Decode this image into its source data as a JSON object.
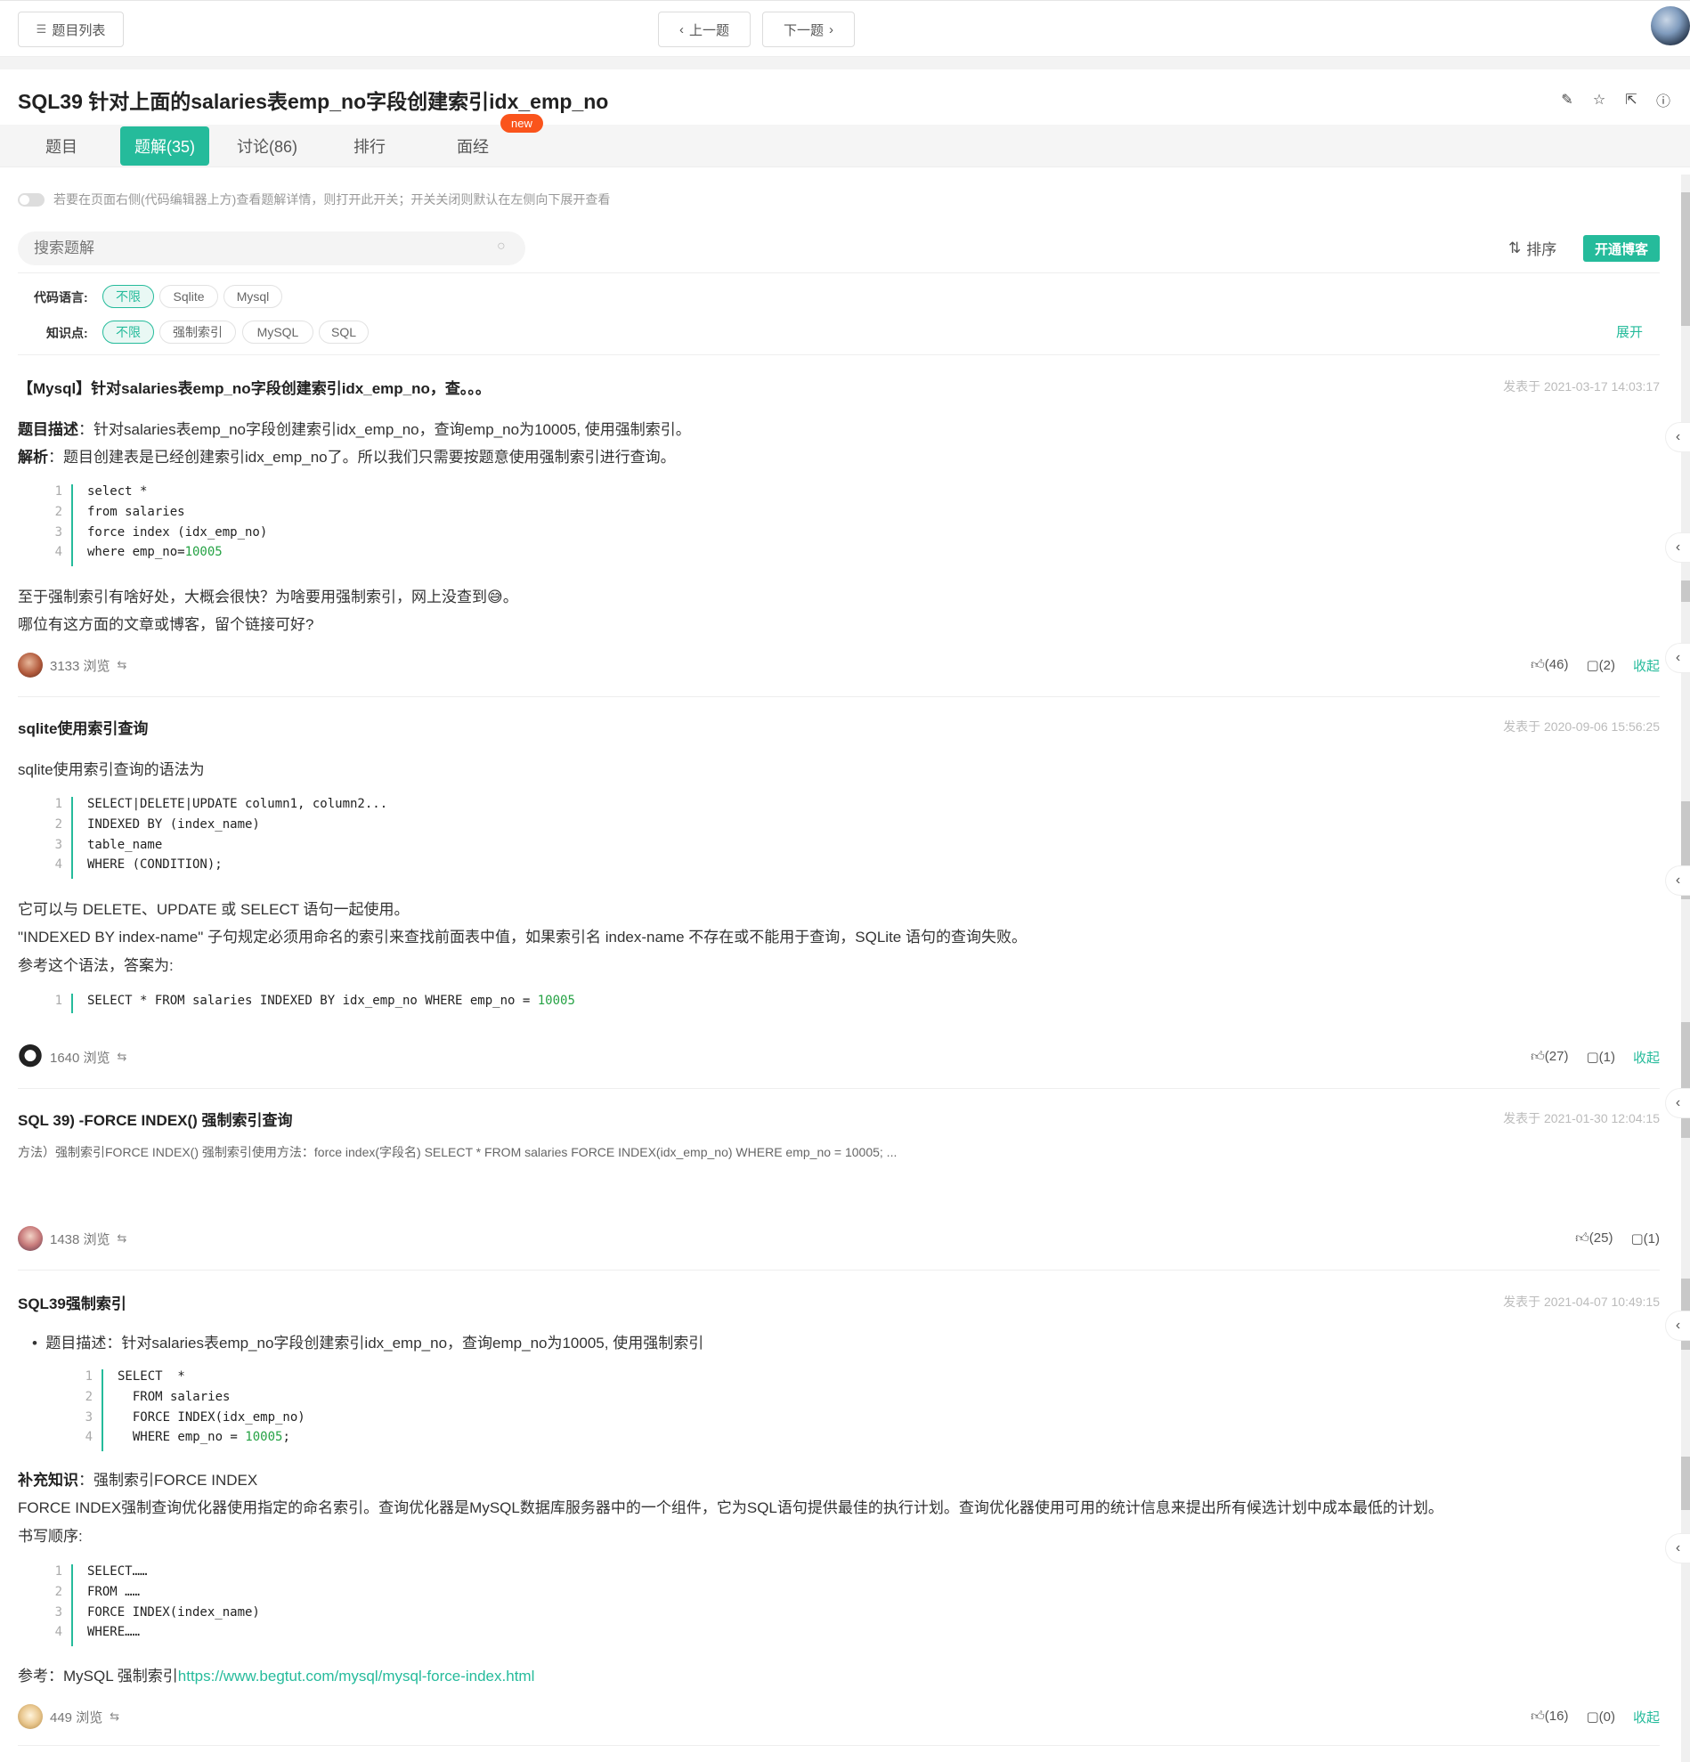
{
  "topbar": {
    "list_label": "题目列表",
    "prev_label": "上一题",
    "next_label": "下一题"
  },
  "problem": {
    "title": "SQL39  针对上面的salaries表emp_no字段创建索引idx_emp_no"
  },
  "tabs": [
    {
      "label": "题目"
    },
    {
      "label": "题解(35)"
    },
    {
      "label": "讨论(86)"
    },
    {
      "label": "排行"
    },
    {
      "label": "面经"
    }
  ],
  "new_badge": "new",
  "toggle_hint": "若要在页面右侧(代码编辑器上方)查看题解详情，则打开此开关；开关关闭则默认在左侧向下展开查看",
  "search": {
    "placeholder": "搜索题解"
  },
  "sort_label": "排序",
  "blog_label": "开通博客",
  "filters": {
    "lang_label": "代码语言:",
    "lang_options": [
      "不限",
      "Sqlite",
      "Mysql"
    ],
    "kp_label": "知识点:",
    "kp_options": [
      "不限",
      "强制索引",
      "MySQL",
      "SQL"
    ],
    "expand": "展开"
  },
  "posts": [
    {
      "title": "【Mysql】针对salaries表emp_no字段创建索引idx_emp_no，查。。。",
      "date": "发表于 2021-03-17 14:03:17",
      "desc_label": "题目描述",
      "desc": "：针对salaries表emp_no字段创建索引idx_emp_no，查询emp_no为10005, 使用强制索引。",
      "analysis_label": "解析",
      "analysis": "：题目创建表是已经创建索引idx_emp_no了。所以我们只需要按题意使用强制索引进行查询。",
      "code": [
        "select *",
        "from salaries",
        "force index (idx_emp_no)",
        "where emp_no="
      ],
      "code_num": "10005",
      "extra1": "至于强制索引有啥好处，大概会很快？为啥要用强制索引，网上没查到😅。",
      "extra2": "哪位有这方面的文章或博客，留个链接可好?",
      "views": "3133 浏览",
      "likes": "(46)",
      "comments": "(2)",
      "collapse": "收起"
    },
    {
      "title": "sqlite使用索引查询",
      "date": "发表于 2020-09-06 15:56:25",
      "intro": "sqlite使用索引查询的语法为",
      "code": [
        "SELECT|DELETE|UPDATE column1, column2...",
        "INDEXED BY (index_name)",
        "table_name",
        "WHERE (CONDITION);"
      ],
      "p1": "它可以与 DELETE、UPDATE 或 SELECT 语句一起使用。",
      "p2": "\"INDEXED BY index-name\" 子句规定必须用命名的索引来查找前面表中值，如果索引名 index-name 不存在或不能用于查询，SQLite 语句的查询失败。",
      "p3": "参考这个语法，答案为:",
      "code2": "SELECT * FROM salaries INDEXED BY idx_emp_no WHERE emp_no = ",
      "code2_num": "10005",
      "views": "1640 浏览",
      "likes": "(27)",
      "comments": "(1)",
      "collapse": "收起"
    },
    {
      "title": "SQL 39) -FORCE INDEX() 强制索引查询",
      "date": "发表于 2021-01-30 12:04:15",
      "summary": "方法）强制索引FORCE INDEX() 强制索引使用方法：force index(字段名) SELECT * FROM salaries FORCE INDEX(idx_emp_no) WHERE emp_no = 10005; ...",
      "views": "1438 浏览",
      "likes": "(25)",
      "comments": "(1)"
    },
    {
      "title": "SQL39强制索引",
      "date": "发表于 2021-04-07 10:49:15",
      "bullet": "题目描述：针对salaries表emp_no字段创建索引idx_emp_no，查询emp_no为10005, 使用强制索引",
      "code": [
        "SELECT  *",
        "  FROM salaries",
        "  FORCE INDEX(idx_emp_no)",
        "  WHERE emp_no = "
      ],
      "code_num": "10005",
      "supp_label": "补充知识",
      "supp": "：强制索引FORCE INDEX",
      "p1": "FORCE INDEX强制查询优化器使用指定的命名索引。查询优化器是MySQL数据库服务器中的一个组件，它为SQL语句提供最佳的执行计划。查询优化器使用可用的统计信息来提出所有候选计划中成本最低的计划。",
      "p2": "书写顺序:",
      "code2": [
        "SELECT……",
        "FROM ……",
        "FORCE INDEX(index_name)",
        "WHERE……"
      ],
      "ref_label": "参考：MySQL 强制索引",
      "ref_link": "https://www.begtut.com/mysql/mysql-force-index.html",
      "views": "449 浏览",
      "likes": "(16)",
      "comments": "(0)",
      "collapse": "收起"
    }
  ]
}
